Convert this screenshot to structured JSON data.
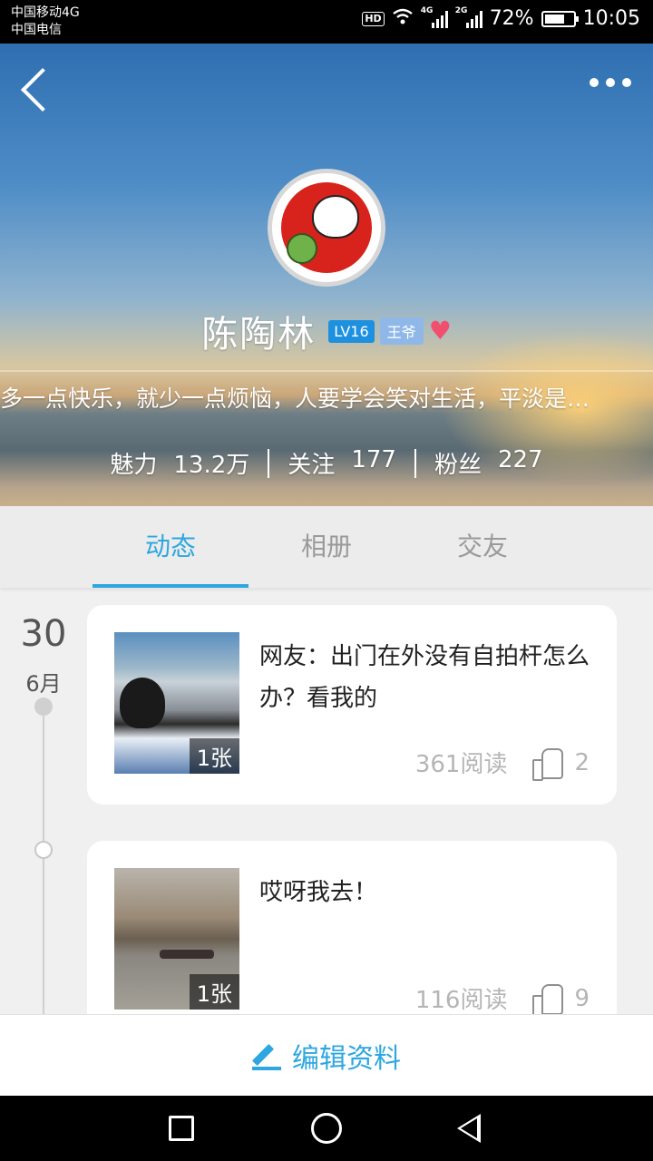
{
  "status_bar": {
    "carrier_1": "中国移动4G",
    "carrier_2": "中国电信",
    "hd": "HD",
    "net_1": "4G",
    "net_2": "2G",
    "battery_pct": "72%",
    "battery_level": 0.72,
    "time": "10:05"
  },
  "profile": {
    "name": "陈陶林",
    "level": "LV16",
    "title_badge": "王爷",
    "signature": "多一点快乐，就少一点烦恼，人要学会笑对生活，平淡是…",
    "stats": [
      {
        "label": "魅力",
        "value": "13.2万"
      },
      {
        "label": "关注",
        "value": "177"
      },
      {
        "label": "粉丝",
        "value": "227"
      }
    ]
  },
  "tabs": [
    {
      "label": "动态",
      "active": true
    },
    {
      "label": "相册",
      "active": false
    },
    {
      "label": "交友",
      "active": false
    }
  ],
  "timeline": {
    "day": "30",
    "month": "6月",
    "posts": [
      {
        "text": "网友：出门在外没有自拍杆怎么办？看我的",
        "image_count": "1张",
        "reads": "361阅读",
        "likes": "2"
      },
      {
        "text": "哎呀我去！",
        "image_count": "1张",
        "reads": "116阅读",
        "likes": "9"
      }
    ]
  },
  "edit_bar": {
    "label": "编辑资料"
  },
  "colors": {
    "accent": "#2ea7e0",
    "level_badge": "#1e90e0",
    "title_badge": "#8fb8e8",
    "heart": "#f0506e"
  },
  "icons": [
    "back-icon",
    "more-icon",
    "heart-icon",
    "like-icon",
    "pencil-icon",
    "nav-recents-icon",
    "nav-home-icon",
    "nav-back-icon"
  ]
}
